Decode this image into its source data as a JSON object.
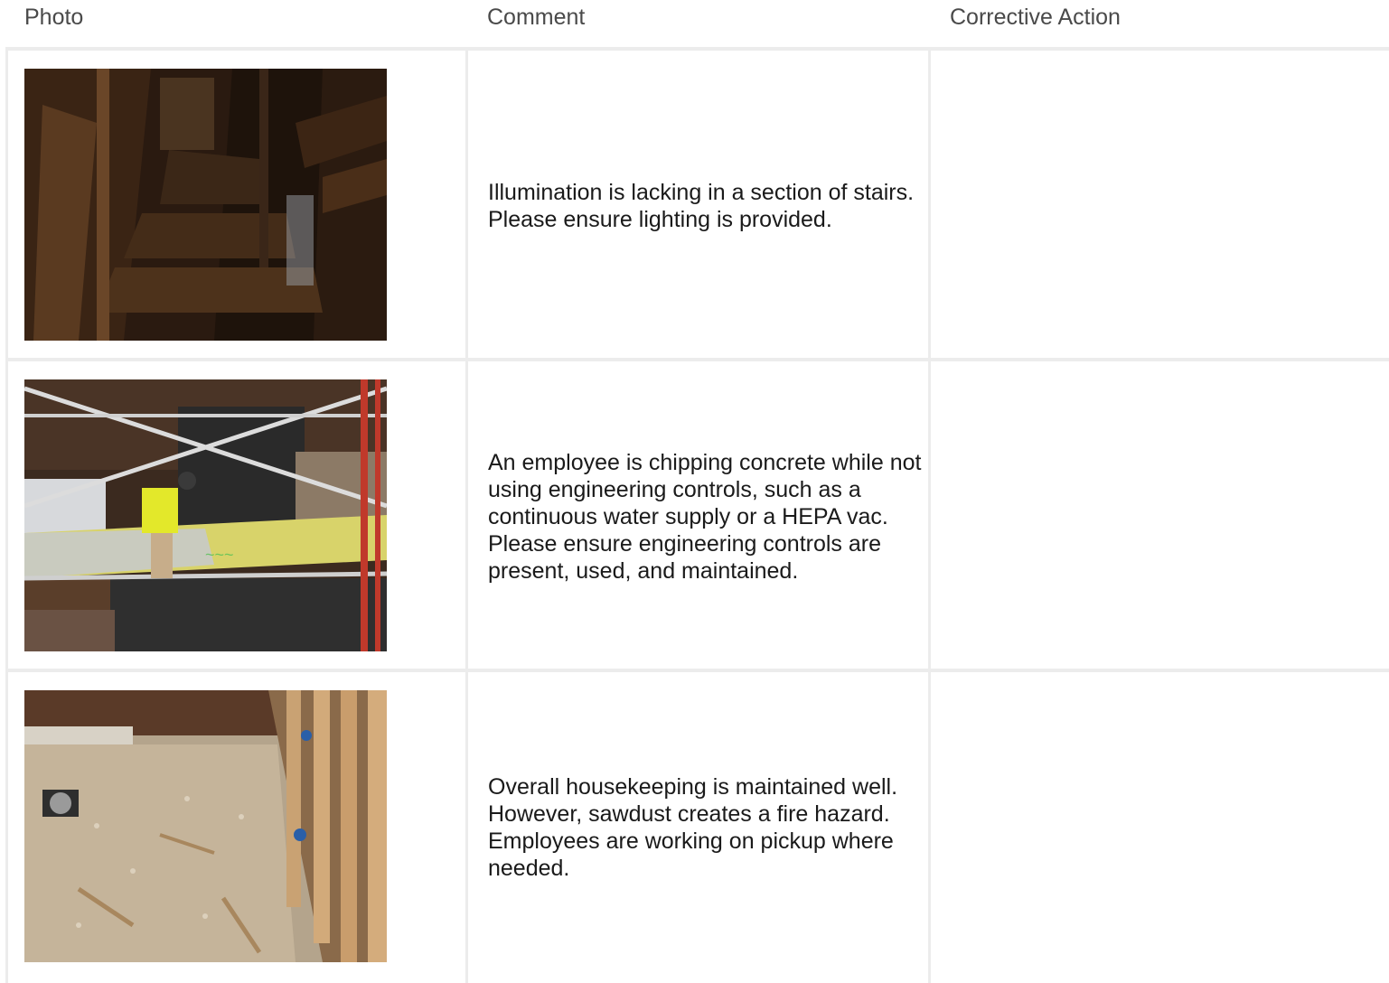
{
  "table": {
    "headers": {
      "photo": "Photo",
      "comment": "Comment",
      "corrective_action": "Corrective Action"
    },
    "rows": [
      {
        "photo_icon": "stairs-photo",
        "comment": "Illumination is lacking in a section of stairs. Please ensure lighting is provided.",
        "corrective_action": ""
      },
      {
        "photo_icon": "scaffold-worker-photo",
        "comment": "An employee is chipping concrete while not using engineering controls, such as a continuous water supply or a HEPA vac. Please ensure engineering controls are present, used, and maintained.",
        "corrective_action": ""
      },
      {
        "photo_icon": "sawdust-floor-photo",
        "comment": "Overall housekeeping is maintained well. However, sawdust creates a fire hazard. Employees are working on pickup where needed.",
        "corrective_action": ""
      }
    ]
  },
  "colors": {
    "grid_line": "#ececec",
    "header_text": "#4a4a4a",
    "body_text": "#1a1a1a"
  }
}
